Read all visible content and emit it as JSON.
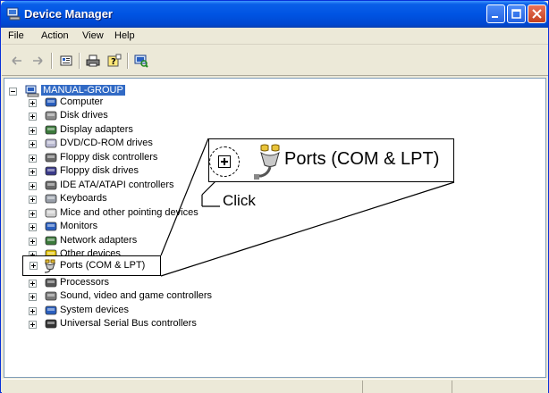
{
  "window": {
    "title": "Device Manager",
    "title_icon": "device-manager-icon"
  },
  "menu": [
    "File",
    "Action",
    "View",
    "Help"
  ],
  "toolbar": {
    "icons": [
      "back-arrow-icon",
      "forward-arrow-icon",
      "properties-icon",
      "print-icon",
      "help-icon",
      "scan-hardware-icon"
    ]
  },
  "tree": {
    "root": "MANUAL-GROUP",
    "items": [
      {
        "label": "Computer",
        "icon": "computer-icon"
      },
      {
        "label": "Disk drives",
        "icon": "disk-drive-icon"
      },
      {
        "label": "Display adapters",
        "icon": "display-adapter-icon"
      },
      {
        "label": "DVD/CD-ROM drives",
        "icon": "cdrom-icon"
      },
      {
        "label": "Floppy disk controllers",
        "icon": "floppy-controller-icon"
      },
      {
        "label": "Floppy disk drives",
        "icon": "floppy-drive-icon"
      },
      {
        "label": "IDE ATA/ATAPI controllers",
        "icon": "ide-controller-icon"
      },
      {
        "label": "Keyboards",
        "icon": "keyboard-icon"
      },
      {
        "label": "Mice and other pointing devices",
        "icon": "mouse-icon"
      },
      {
        "label": "Monitors",
        "icon": "monitor-icon"
      },
      {
        "label": "Network adapters",
        "icon": "network-adapter-icon"
      },
      {
        "label": "Other devices",
        "icon": "other-devices-icon"
      },
      {
        "label": "Ports (COM & LPT)",
        "icon": "port-icon"
      },
      {
        "label": "Processors",
        "icon": "processor-icon"
      },
      {
        "label": "Sound, video and game controllers",
        "icon": "sound-icon"
      },
      {
        "label": "System devices",
        "icon": "system-devices-icon"
      },
      {
        "label": "Universal Serial Bus controllers",
        "icon": "usb-icon"
      }
    ]
  },
  "callout": {
    "big_label": "Ports (COM & LPT)",
    "small_label": "Ports (COM & LPT)",
    "click_label": "Click"
  },
  "colors": {
    "titlebar": "#0054e3",
    "selection": "#316ac5",
    "chrome": "#ece9d8"
  }
}
